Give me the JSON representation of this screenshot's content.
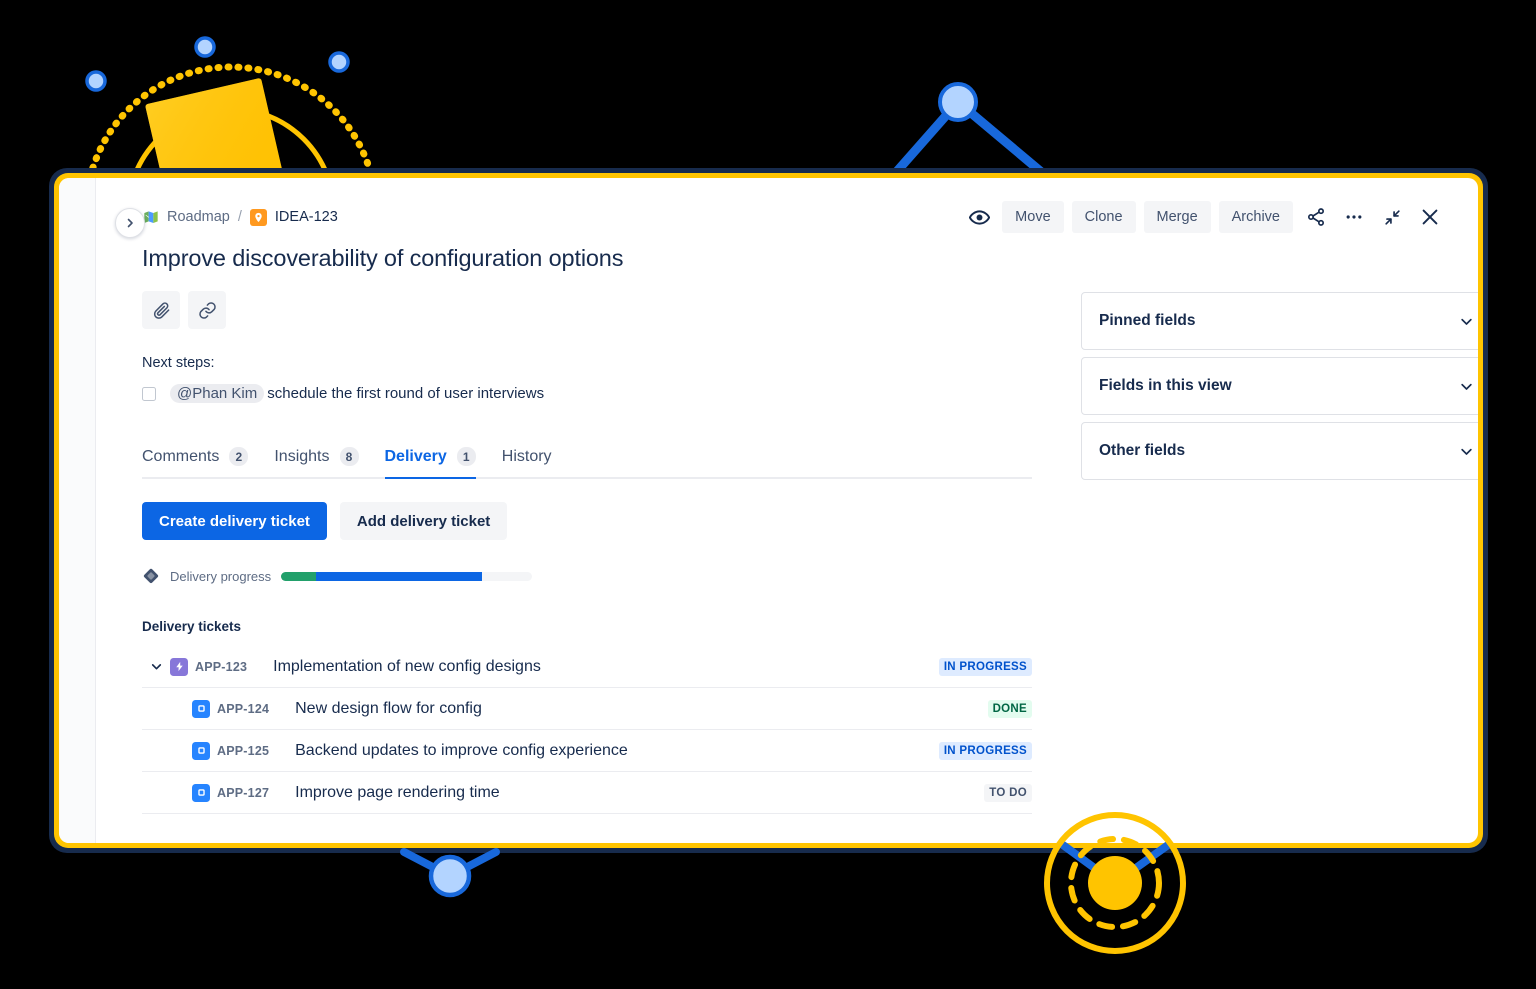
{
  "breadcrumb": {
    "project_icon": "map-icon",
    "project_label": "Roadmap",
    "separator": "/",
    "key_icon": "idea-marker-icon",
    "issue_key": "IDEA-123"
  },
  "header_actions": {
    "watch_icon": "eye-icon",
    "buttons": [
      "Move",
      "Clone",
      "Merge",
      "Archive"
    ],
    "share_icon": "share-icon",
    "more_icon": "more-ellipsis-icon",
    "collapse_icon": "collapse-diagonal-icon",
    "close_icon": "close-icon"
  },
  "collapse_sidebar_icon": "chevron-right-icon",
  "issue": {
    "title": "Improve discoverability of configuration options",
    "quick_actions": [
      {
        "name": "attach-icon",
        "glyph": "attachment"
      },
      {
        "name": "link-icon",
        "glyph": "link"
      }
    ],
    "next_steps_label": "Next steps:",
    "task": {
      "checked": false,
      "mention": "@Phan Kim",
      "text": "schedule the first round of user interviews"
    }
  },
  "tabs": [
    {
      "label": "Comments",
      "count": "2",
      "active": false
    },
    {
      "label": "Insights",
      "count": "8",
      "active": false
    },
    {
      "label": "Delivery",
      "count": "1",
      "active": true
    },
    {
      "label": "History",
      "count": "",
      "active": false
    }
  ],
  "delivery": {
    "create_button": "Create delivery ticket",
    "add_button": "Add delivery ticket",
    "progress": {
      "icon": "delivery-diamond-icon",
      "label": "Delivery progress",
      "done_percent": 14,
      "in_progress_percent": 66,
      "todo_percent": 20
    },
    "tickets_label": "Delivery tickets",
    "tickets": [
      {
        "key": "APP-123",
        "summary": "Implementation of new config designs",
        "status": "IN PROGRESS",
        "status_kind": "inprogress",
        "type": "epic",
        "type_icon": "epic-bolt-icon",
        "child": false,
        "expanded": true
      },
      {
        "key": "APP-124",
        "summary": "New design flow for config",
        "status": "DONE",
        "status_kind": "done",
        "type": "story",
        "type_icon": "story-icon",
        "child": true
      },
      {
        "key": "APP-125",
        "summary": "Backend updates to improve config experience",
        "status": "IN PROGRESS",
        "status_kind": "inprogress",
        "type": "story",
        "type_icon": "story-icon",
        "child": true
      },
      {
        "key": "APP-127",
        "summary": "Improve page rendering time",
        "status": "TO DO",
        "status_kind": "todo",
        "type": "story",
        "type_icon": "story-icon",
        "child": true
      }
    ]
  },
  "side_panels": [
    {
      "title": "Pinned fields",
      "chevron": "chevron-down-icon"
    },
    {
      "title": "Fields in this view",
      "chevron": "chevron-down-icon"
    },
    {
      "title": "Other fields",
      "chevron": "chevron-down-icon"
    }
  ],
  "colors": {
    "background": "#000000",
    "card_border_outer": "#172B4D",
    "card_border_inner": "#FFC400",
    "accent_blue": "#0C66E4",
    "decor_yellow": "#FFC400",
    "decor_blue": "#1868DB",
    "decor_blue_fill": "#B3D4FF",
    "status_inprogress_bg": "#DEEBFF",
    "status_inprogress_fg": "#0052CC",
    "status_done_bg": "#E3FCEF",
    "status_done_fg": "#006644",
    "status_todo_bg": "#F4F5F7",
    "status_todo_fg": "#42526E",
    "progress_green": "#22A06B",
    "progress_blue": "#0C66E4",
    "epic_purple": "#8777D9",
    "story_blue": "#2684FF"
  }
}
